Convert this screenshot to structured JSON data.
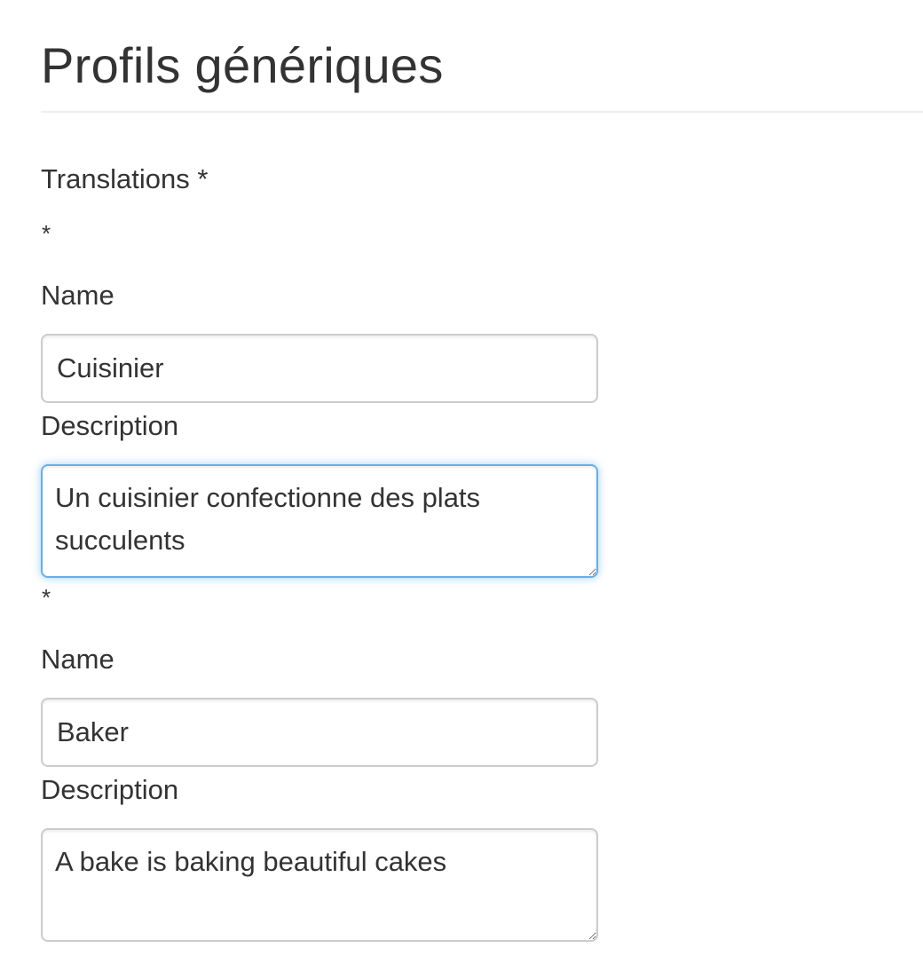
{
  "page": {
    "title": "Profils génériques"
  },
  "form": {
    "translations_label": "Translations *",
    "entries": [
      {
        "required_marker": "*",
        "name_label": "Name",
        "name_value": "Cuisinier",
        "description_label": "Description",
        "description_value": "Un cuisinier confectionne des plats succulents",
        "focused": true
      },
      {
        "required_marker": "*",
        "name_label": "Name",
        "name_value": "Baker",
        "description_label": "Description",
        "description_value": "A bake is baking beautiful cakes",
        "focused": false
      }
    ]
  },
  "colors": {
    "text": "#333333",
    "border": "#cccccc",
    "focus_border": "#66afe9",
    "divider": "#eeeeee"
  }
}
